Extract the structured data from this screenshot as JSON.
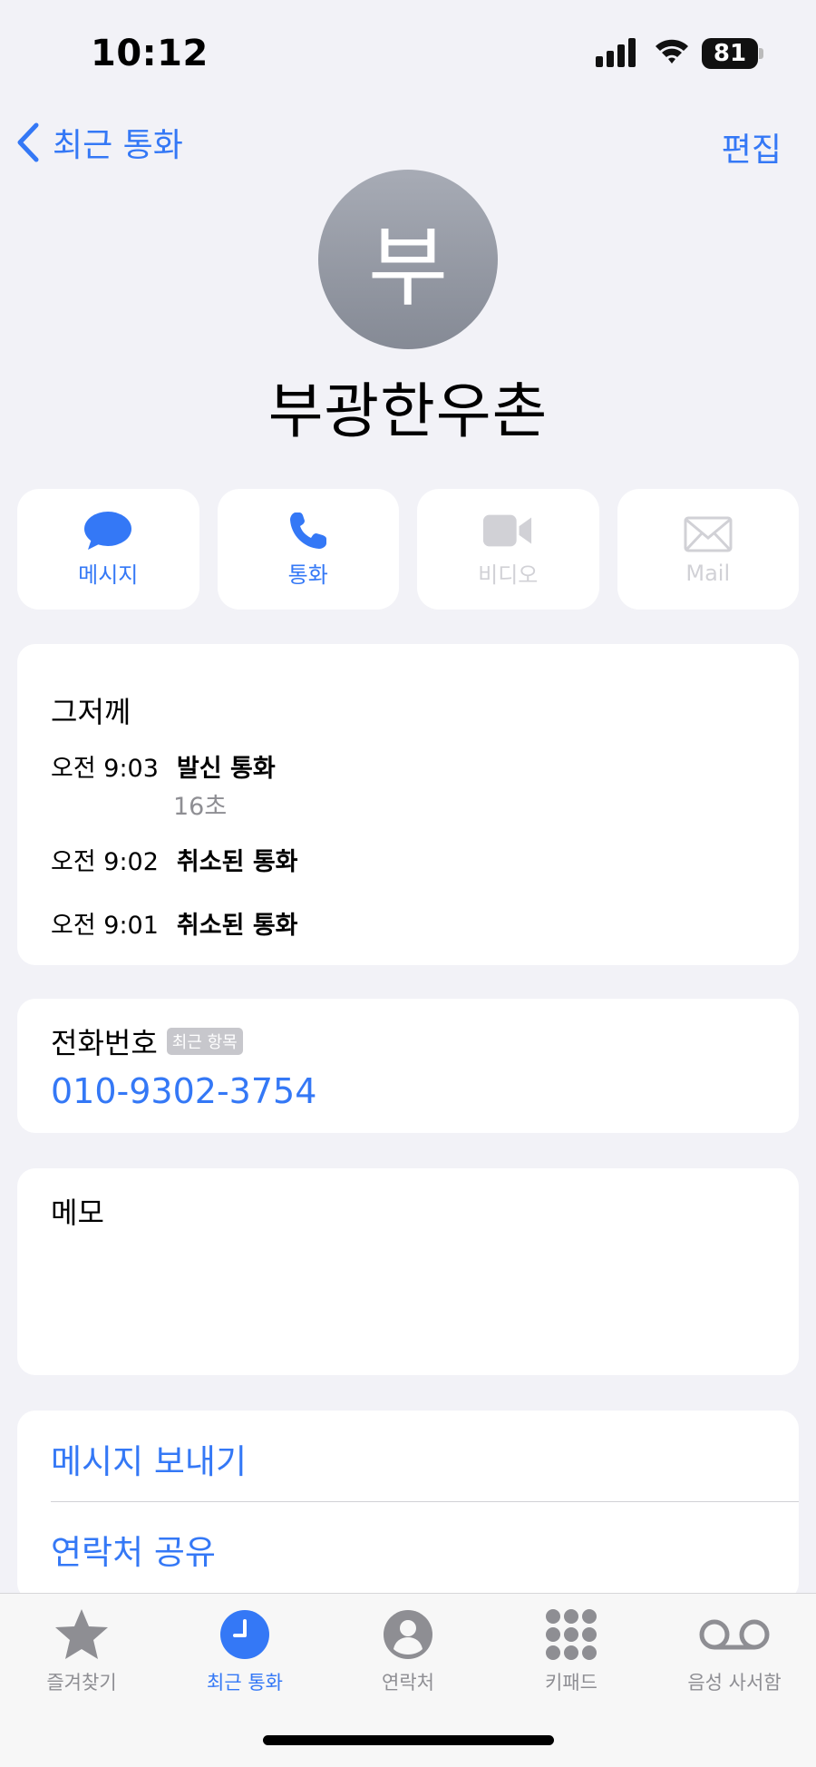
{
  "status": {
    "time": "10:12",
    "battery": "81"
  },
  "nav": {
    "back_label": "최근 통화",
    "edit_label": "편집"
  },
  "contact": {
    "initial": "부",
    "name": "부광한우촌"
  },
  "actions": [
    {
      "label": "메시지",
      "icon": "message-bubble-icon",
      "enabled": true
    },
    {
      "label": "통화",
      "icon": "phone-icon",
      "enabled": true
    },
    {
      "label": "비디오",
      "icon": "video-camera-icon",
      "enabled": false
    },
    {
      "label": "Mail",
      "icon": "envelope-icon",
      "enabled": false
    }
  ],
  "recents": {
    "date_label": "그저께",
    "calls": [
      {
        "time": "오전 9:03",
        "type": "발신 통화",
        "duration": "16초"
      },
      {
        "time": "오전 9:02",
        "type": "취소된 통화"
      },
      {
        "time": "오전 9:01",
        "type": "취소된 통화"
      }
    ]
  },
  "phone": {
    "label": "전화번호",
    "badge": "최근 항목",
    "number": "010-9302-3754"
  },
  "memo": {
    "label": "메모"
  },
  "links": [
    {
      "label": "메시지 보내기"
    },
    {
      "label": "연락처 공유"
    }
  ],
  "tabs": [
    {
      "label": "즐겨찾기",
      "icon": "star-icon",
      "active": false
    },
    {
      "label": "최근 통화",
      "icon": "clock-icon",
      "active": true
    },
    {
      "label": "연락처",
      "icon": "person-icon",
      "active": false
    },
    {
      "label": "키패드",
      "icon": "keypad-icon",
      "active": false
    },
    {
      "label": "음성 사서함",
      "icon": "voicemail-icon",
      "active": false
    }
  ],
  "colors": {
    "accent": "#3478f6",
    "background": "#f2f2f7",
    "disabled": "#d1d1d6",
    "inactive_tab": "#8e8e93"
  }
}
